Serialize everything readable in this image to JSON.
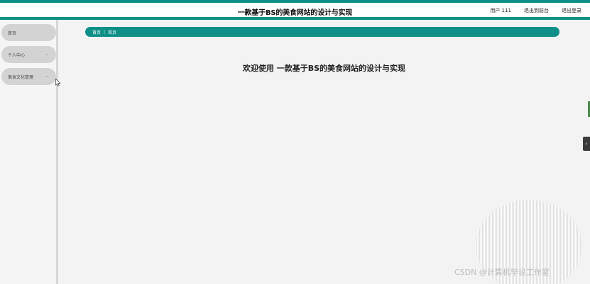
{
  "header": {
    "site_title": "一款基于BS的美食网站的设计与实现",
    "user_label": "用户 111",
    "back_to_admin": "退出到前台",
    "logout": "退出登录"
  },
  "sidebar": {
    "items": [
      {
        "label": "首页"
      },
      {
        "label": "个人中心"
      },
      {
        "label": "美食文化管理"
      }
    ]
  },
  "breadcrumb": {
    "root": "首页",
    "separator": "|",
    "current": "首页"
  },
  "main": {
    "welcome": "欢迎使用 一款基于BS的美食网站的设计与实现"
  },
  "watermark": {
    "text": "CSDN @计算机毕设工作室"
  },
  "colors": {
    "accent": "#0e8f87"
  }
}
